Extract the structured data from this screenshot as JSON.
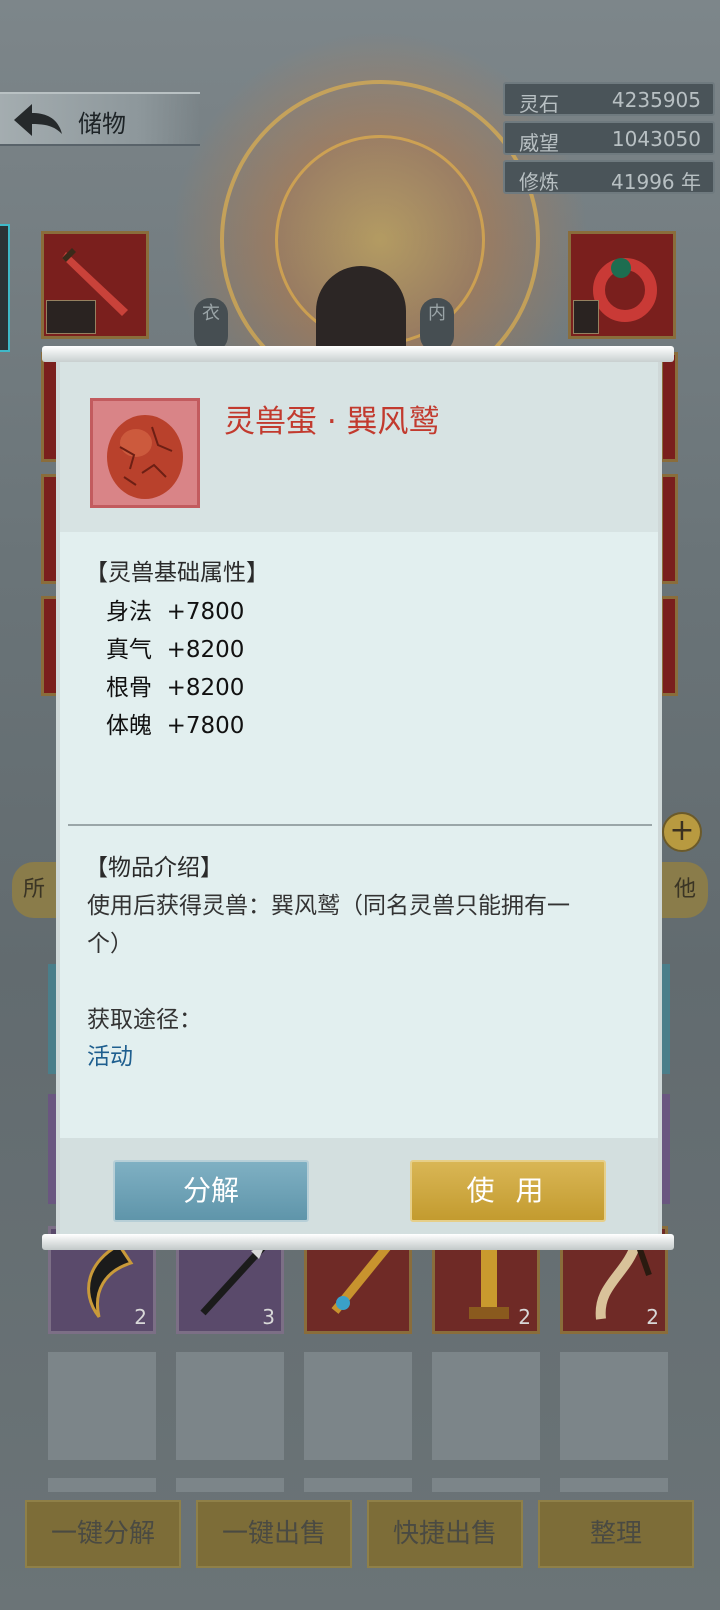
{
  "header": {
    "title": "储物",
    "back_icon": "back-arrow-icon"
  },
  "stats": [
    {
      "name": "灵石",
      "value": "4235905"
    },
    {
      "name": "威望",
      "value": "1043050"
    },
    {
      "name": "修炼",
      "value": "41996 年"
    }
  ],
  "equip": {
    "left_label": "衣",
    "right_label": "内"
  },
  "popup": {
    "item_name": "灵兽蛋 · 巽风鹫",
    "attr_title": "【灵兽基础属性】",
    "attrs": [
      {
        "name": "身法",
        "value": "+7800"
      },
      {
        "name": "真气",
        "value": "+8200"
      },
      {
        "name": "根骨",
        "value": "+8200"
      },
      {
        "name": "体魄",
        "value": "+7800"
      }
    ],
    "intro_title": "【物品介绍】",
    "intro_line1": "使用后获得灵兽：巽风鹫（同名灵兽只能拥有一",
    "intro_line2": "个）",
    "source_label": "获取途径：",
    "source_value": "活动",
    "decompose_label": "分解",
    "use_label": "使 用"
  },
  "tabs": {
    "left": "所",
    "right": "他"
  },
  "inventory_counts": [
    "2",
    "3",
    "",
    "2",
    "2"
  ],
  "bottom_buttons": [
    "一键分解",
    "一键出售",
    "快捷出售",
    "整理"
  ],
  "colors": {
    "accent_red": "#c23a2e",
    "use_gold": "#c9a43a",
    "decompose_blue": "#6fa3b7",
    "link_blue": "#1f5f8f"
  }
}
